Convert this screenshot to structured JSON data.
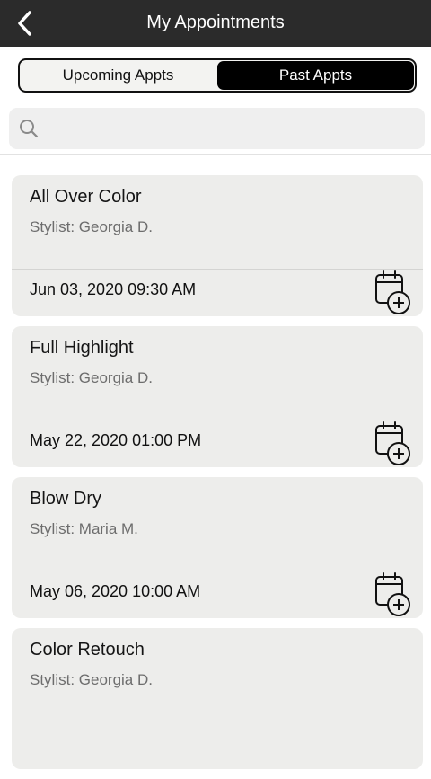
{
  "header": {
    "title": "My Appointments"
  },
  "tabs": [
    {
      "label": "Upcoming Appts",
      "active": false
    },
    {
      "label": "Past Appts",
      "active": true
    }
  ],
  "search": {
    "placeholder": "",
    "value": ""
  },
  "appointments": [
    {
      "service": "All Over Color",
      "stylist": "Stylist: Georgia D.",
      "datetime": "Jun 03, 2020 09:30 AM"
    },
    {
      "service": "Full Highlight",
      "stylist": "Stylist: Georgia D.",
      "datetime": "May 22, 2020 01:00 PM"
    },
    {
      "service": "Blow Dry",
      "stylist": "Stylist: Maria M.",
      "datetime": "May 06, 2020 10:00 AM"
    },
    {
      "service": "Color Retouch",
      "stylist": "Stylist: Georgia D.",
      "datetime": ""
    }
  ],
  "icons": {
    "back": "chevron-left-icon",
    "search": "search-icon",
    "add_calendar": "calendar-add-icon"
  },
  "colors": {
    "header_bg": "#2b2b2b",
    "active_tab_bg": "#000000",
    "card_bg": "#ededeb"
  }
}
